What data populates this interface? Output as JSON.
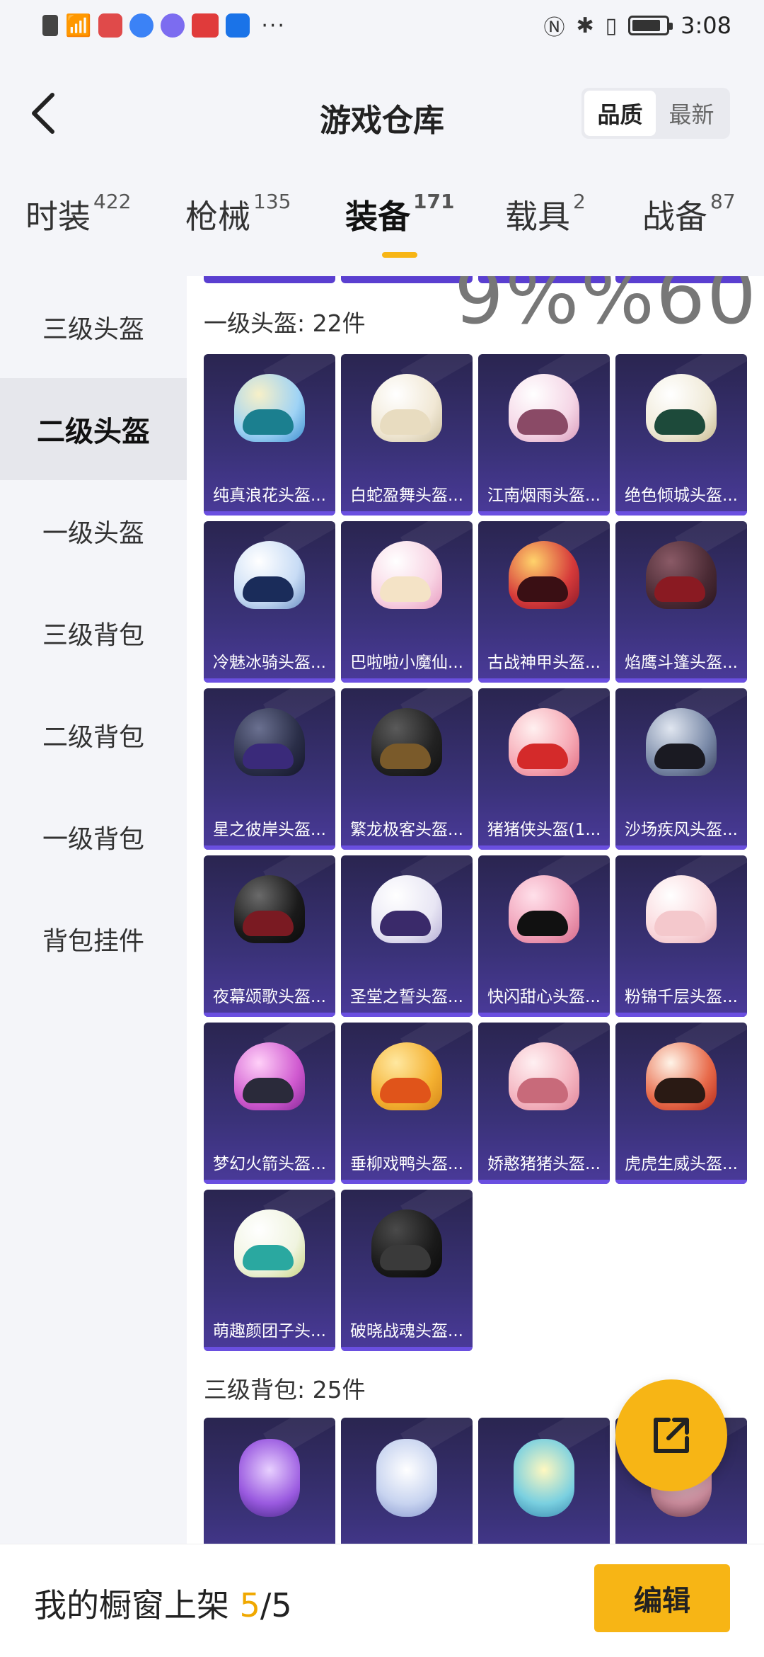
{
  "status_bar": {
    "time": "3:08",
    "more": "···"
  },
  "header": {
    "title": "游戏仓库",
    "sort_options": [
      "品质",
      "最新"
    ],
    "active_sort": "品质"
  },
  "tabs": [
    {
      "label": "时装",
      "count": "422"
    },
    {
      "label": "枪械",
      "count": "135"
    },
    {
      "label": "装备",
      "count": "171"
    },
    {
      "label": "载具",
      "count": "2"
    },
    {
      "label": "战备",
      "count": "87"
    }
  ],
  "active_tab": "装备",
  "sidebar": {
    "items": [
      "三级头盔",
      "二级头盔",
      "一级头盔",
      "三级背包",
      "二级背包",
      "一级背包",
      "背包挂件"
    ],
    "active": "二级头盔"
  },
  "content": {
    "watermark": "9%%60",
    "section1": {
      "title": "一级头盔: 22件",
      "items": [
        "纯真浪花头盔...",
        "白蛇盈舞头盔...",
        "江南烟雨头盔...",
        "绝色倾城头盔...",
        "冷魅冰骑头盔...",
        "巴啦啦小魔仙...",
        "古战神甲头盔...",
        "焰鹰斗篷头盔...",
        "星之彼岸头盔...",
        "繁龙极客头盔...",
        "猪猪侠头盔(1...",
        "沙场疾风头盔...",
        "夜幕颂歌头盔...",
        "圣堂之誓头盔...",
        "快闪甜心头盔...",
        "粉锦千层头盔...",
        "梦幻火箭头盔...",
        "垂柳戏鸭头盔...",
        "娇憨猪猪头盔...",
        "虎虎生威头盔...",
        "萌趣颜团子头...",
        "破晓战魂头盔..."
      ]
    },
    "section2": {
      "title": "三级背包: 25件"
    }
  },
  "bottom": {
    "label": "我的橱窗上架 ",
    "used": "5",
    "total": "/5",
    "edit_label": "编辑"
  },
  "colors": {
    "accent": "#f7b515",
    "card_bg": "#2f2a62",
    "card_bottom": "#6a4fe0"
  },
  "icons": [
    "back-chevron-icon",
    "share-external-icon",
    "nfc-icon",
    "bluetooth-icon",
    "vibrate-icon",
    "battery-icon",
    "wifi-icon"
  ]
}
